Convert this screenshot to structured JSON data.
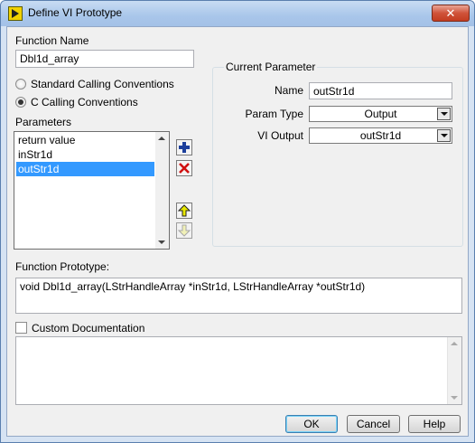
{
  "window": {
    "title": "Define VI Prototype",
    "close_glyph": "✕"
  },
  "function_name": {
    "label": "Function Name",
    "value": "Dbl1d_array"
  },
  "calling": {
    "standard_label": "Standard Calling Conventions",
    "c_label": "C Calling Conventions",
    "selected": "c"
  },
  "parameters": {
    "label": "Parameters",
    "items": [
      {
        "label": "return value",
        "selected": false
      },
      {
        "label": "inStr1d",
        "selected": false
      },
      {
        "label": "outStr1d",
        "selected": true
      }
    ]
  },
  "current_parameter": {
    "title": "Current Parameter",
    "name_label": "Name",
    "name_value": "outStr1d",
    "param_type_label": "Param Type",
    "param_type_value": "Output",
    "vi_output_label": "VI Output",
    "vi_output_value": "outStr1d"
  },
  "function_prototype": {
    "label": "Function Prototype:",
    "value": "void Dbl1d_array(LStrHandleArray *inStr1d, LStrHandleArray *outStr1d)"
  },
  "custom_documentation": {
    "label": "Custom Documentation",
    "checked": false,
    "text": ""
  },
  "buttons": {
    "ok": "OK",
    "cancel": "Cancel",
    "help": "Help"
  },
  "icons": {
    "add": "plus-icon",
    "delete": "x-icon",
    "move_up": "arrow-up-icon",
    "move_down": "arrow-down-icon"
  },
  "colors": {
    "selection": "#3399ff",
    "title_bar": "#a9c6ea",
    "close_button": "#c33c20",
    "add_icon": "#1c3f9c",
    "delete_icon": "#d01010",
    "arrow_up_icon": "#e8e800"
  }
}
